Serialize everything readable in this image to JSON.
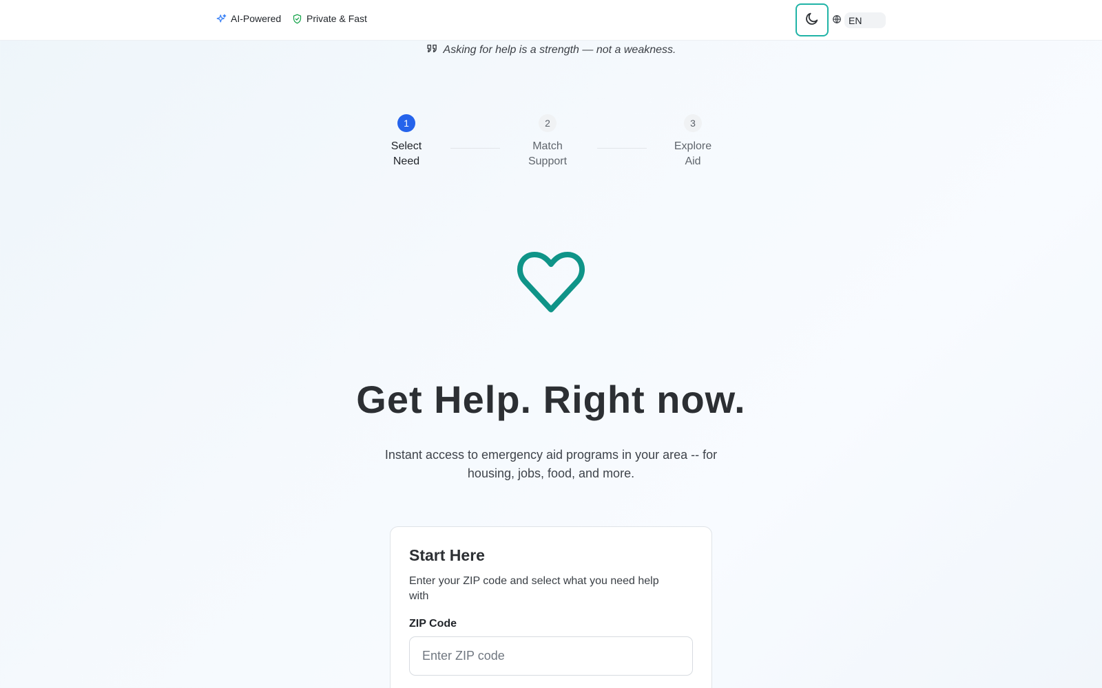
{
  "header": {
    "badges": [
      {
        "label": "AI-Powered",
        "icon": "sparkles-icon",
        "color": "#3b82f6"
      },
      {
        "label": "Private & Fast",
        "icon": "shield-check-icon",
        "color": "#16a34a"
      }
    ],
    "theme_toggle_icon": "moon-icon",
    "language": {
      "icon": "globe-icon",
      "code": "EN"
    }
  },
  "quote": {
    "icon": "quote-icon",
    "text": "Asking for help is a strength — not a weakness."
  },
  "steps": [
    {
      "number": "1",
      "label": "Select\nNeed",
      "active": true
    },
    {
      "number": "2",
      "label": "Match\nSupport",
      "active": false
    },
    {
      "number": "3",
      "label": "Explore\nAid",
      "active": false
    }
  ],
  "hero": {
    "icon": "heart-icon",
    "icon_color": "#0f9488",
    "title": "Get Help. Right now.",
    "subtitle": "Instant access to emergency aid programs in your area -- for housing, jobs, food, and more."
  },
  "form": {
    "title": "Start Here",
    "description": "Enter your ZIP code and select what you need help with",
    "zip_label": "ZIP Code",
    "zip_placeholder": "Enter ZIP code",
    "zip_value": ""
  },
  "colors": {
    "accent": "#2563eb",
    "teal": "#1fb3a6"
  }
}
